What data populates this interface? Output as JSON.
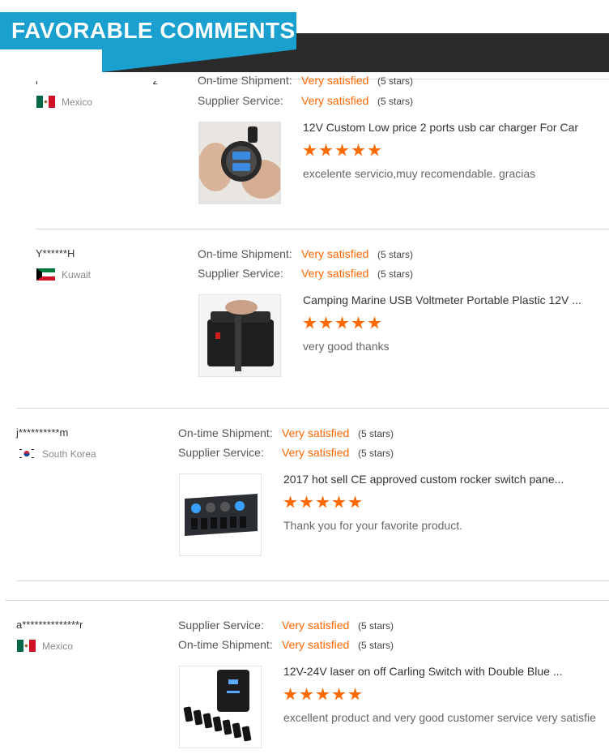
{
  "header": {
    "title": "FAVORABLE COMMENTS"
  },
  "colors": {
    "accent": "#1aa0cf",
    "dark": "#2b2b2b",
    "rating": "#ff6600",
    "star": "#ff6a00"
  },
  "reviews": [
    {
      "user": "l****************************z",
      "country": "Mexico",
      "flag": "mexico-flag",
      "ratings": [
        {
          "label": "On-time Shipment:",
          "value": "Very satisfied",
          "stars": "(5 stars)"
        },
        {
          "label": "Supplier Service:",
          "value": "Very satisfied",
          "stars": "(5 stars)"
        }
      ],
      "product": "12V Custom Low price 2 ports usb car charger For Car",
      "star_count": 5,
      "comment": "excelente servicio,muy recomendable. gracias"
    },
    {
      "user": "Y******H",
      "country": "Kuwait",
      "flag": "kuwait-flag",
      "ratings": [
        {
          "label": "On-time Shipment:",
          "value": "Very satisfied",
          "stars": "(5 stars)"
        },
        {
          "label": "Supplier Service:",
          "value": "Very satisfied",
          "stars": "(5 stars)"
        }
      ],
      "product": "Camping Marine USB Voltmeter Portable Plastic 12V ...",
      "star_count": 5,
      "comment": "very good thanks"
    },
    {
      "user": "j**********m",
      "country": "South Korea",
      "flag": "south-korea-flag",
      "ratings": [
        {
          "label": "On-time Shipment:",
          "value": "Very satisfied",
          "stars": "(5 stars)"
        },
        {
          "label": "Supplier Service:",
          "value": "Very satisfied",
          "stars": "(5 stars)"
        }
      ],
      "product": "2017 hot sell CE approved custom rocker switch pane...",
      "star_count": 5,
      "comment": "Thank you for your favorite product."
    },
    {
      "user": "a**************r",
      "country": "Mexico",
      "flag": "mexico-flag",
      "ratings": [
        {
          "label": "Supplier Service:",
          "value": "Very satisfied",
          "stars": "(5 stars)"
        },
        {
          "label": "On-time Shipment:",
          "value": "Very satisfied",
          "stars": "(5 stars)"
        }
      ],
      "product": "12V-24V laser on off Carling Switch with Double Blue ...",
      "star_count": 5,
      "comment": "excellent product and very good customer service very satisfie"
    }
  ]
}
